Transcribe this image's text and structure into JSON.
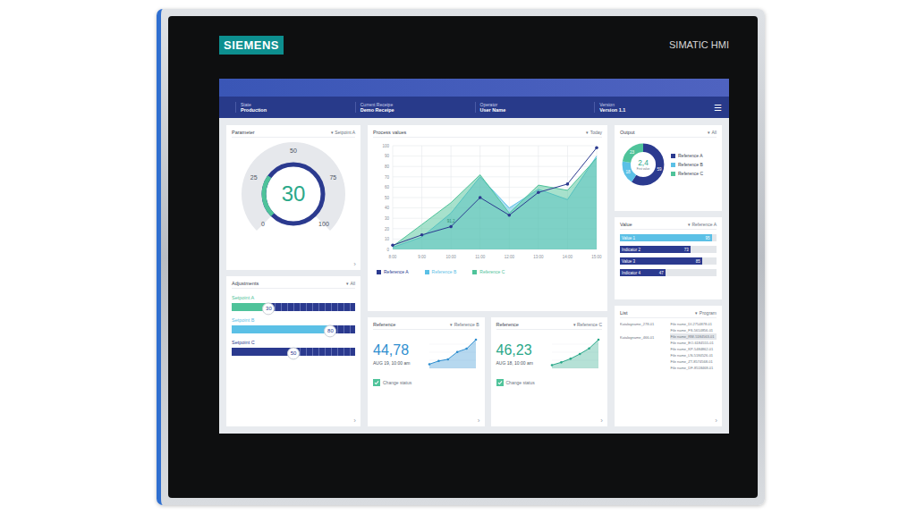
{
  "brand": {
    "logo": "SIEMENS",
    "product": "SIMATIC HMI"
  },
  "filter_icon": "▾",
  "more_icon": "›",
  "header": {
    "items": [
      {
        "label": "State",
        "value": "Production"
      },
      {
        "label": "Current Receipe",
        "value": "Demo Receipe"
      },
      {
        "label": "Operator",
        "value": "User Name"
      },
      {
        "label": "Version",
        "value": "Version 1.1"
      }
    ],
    "menu_icon": "☰"
  },
  "parameter": {
    "title": "Parameter",
    "filter": "Setpoint A",
    "value": "30",
    "level": 0.3,
    "ticks": [
      "0",
      "25",
      "50",
      "75",
      "100"
    ]
  },
  "adjustments": {
    "title": "Adjustments",
    "filter": "All",
    "sliders": [
      {
        "label": "Setpoint A",
        "reading": "30",
        "level": 0.3,
        "color": "#4fc39a"
      },
      {
        "label": "Setpoint B",
        "reading": "80",
        "level": 0.8,
        "color": "#5bc0e6"
      },
      {
        "label": "Setpoint C",
        "reading": "50",
        "level": 0.5,
        "color": "#2b3a8f"
      }
    ]
  },
  "process_values": {
    "title": "Process values",
    "filter": "Today",
    "y_ticks": [
      "100",
      "90",
      "80",
      "70",
      "60",
      "50",
      "40",
      "30",
      "20",
      "10",
      "0"
    ],
    "x_ticks": [
      "8:00",
      "9:00",
      "10:00",
      "11:00",
      "12:00",
      "13:00",
      "14:00",
      "15:00"
    ],
    "callout": {
      "series": 2,
      "index": 2,
      "text": "91,2"
    },
    "series": [
      {
        "name": "Reference B",
        "kind": "area",
        "color": "#5bc0e6",
        "values": [
          2,
          12,
          35,
          70,
          40,
          58,
          48,
          90
        ]
      },
      {
        "name": "Reference C",
        "kind": "area",
        "color": "#4fc39a",
        "values": [
          3,
          24,
          45,
          72,
          35,
          62,
          57,
          88
        ]
      },
      {
        "name": "Reference A",
        "kind": "line",
        "color": "#2b3a8f",
        "values": [
          4,
          14,
          22,
          50,
          33,
          55,
          63,
          98
        ]
      }
    ],
    "legend": [
      {
        "name": "Reference A",
        "color": "#2b3a8f"
      },
      {
        "name": "Reference B",
        "color": "#5bc0e6"
      },
      {
        "name": "Reference C",
        "color": "#4fc39a"
      }
    ]
  },
  "output": {
    "title": "Output",
    "filter": "All",
    "center_value": "2,4",
    "center_label": "First value",
    "segments": [
      {
        "name": "Reference A",
        "value": 59,
        "reading": "59",
        "color": "#2b3a8f"
      },
      {
        "name": "Reference B",
        "value": 18,
        "reading": "18",
        "color": "#5bc0e6"
      },
      {
        "name": "Reference C",
        "value": 23,
        "reading": "23",
        "color": "#4fc39a"
      }
    ]
  },
  "value_card": {
    "title": "Value",
    "filter": "Reference A",
    "bars": [
      {
        "label": "Value 1",
        "reading": "95",
        "level": 0.95,
        "color": "#5bc0e6"
      },
      {
        "label": "Indicator 2",
        "reading": "73",
        "level": 0.73,
        "color": "#2b3a8f"
      },
      {
        "label": "Value 3",
        "reading": "85",
        "level": 0.85,
        "color": "#2b3a8f"
      },
      {
        "label": "Indicator 4",
        "reading": "47",
        "level": 0.47,
        "color": "#2b3a8f"
      }
    ]
  },
  "references": [
    {
      "title": "Reference",
      "filter": "Reference B",
      "value": "44,78",
      "date": "AUG 19, 10:00 am",
      "status_label": "Change status",
      "checked": true,
      "color": "#2f8fd0",
      "values": [
        10,
        18,
        22,
        40,
        48,
        70
      ]
    },
    {
      "title": "Reference",
      "filter": "Reference C",
      "value": "46,23",
      "date": "AUG 18, 10:00 am",
      "status_label": "Change status",
      "checked": true,
      "color": "#2aa889",
      "values": [
        8,
        15,
        24,
        36,
        50,
        72
      ]
    }
  ],
  "list": {
    "title": "List",
    "filter": "Program",
    "names": [
      "Katalogname_278-01",
      "Katalogname_466-01"
    ],
    "files": [
      {
        "text": "File name_DI-2754878-01",
        "selected": false
      },
      {
        "text": "File name_FS-5614856-01",
        "selected": false
      },
      {
        "text": "File name_RW-5184563-01",
        "selected": true
      },
      {
        "text": "File name_EO-6184555-01",
        "selected": false
      },
      {
        "text": "File name_KP-5484862-01",
        "selected": false
      },
      {
        "text": "File name_LN-5184526-01",
        "selected": false
      },
      {
        "text": "File name_ZT-8574568-01",
        "selected": false
      },
      {
        "text": "File name_DF-8518468-01",
        "selected": false
      }
    ]
  }
}
